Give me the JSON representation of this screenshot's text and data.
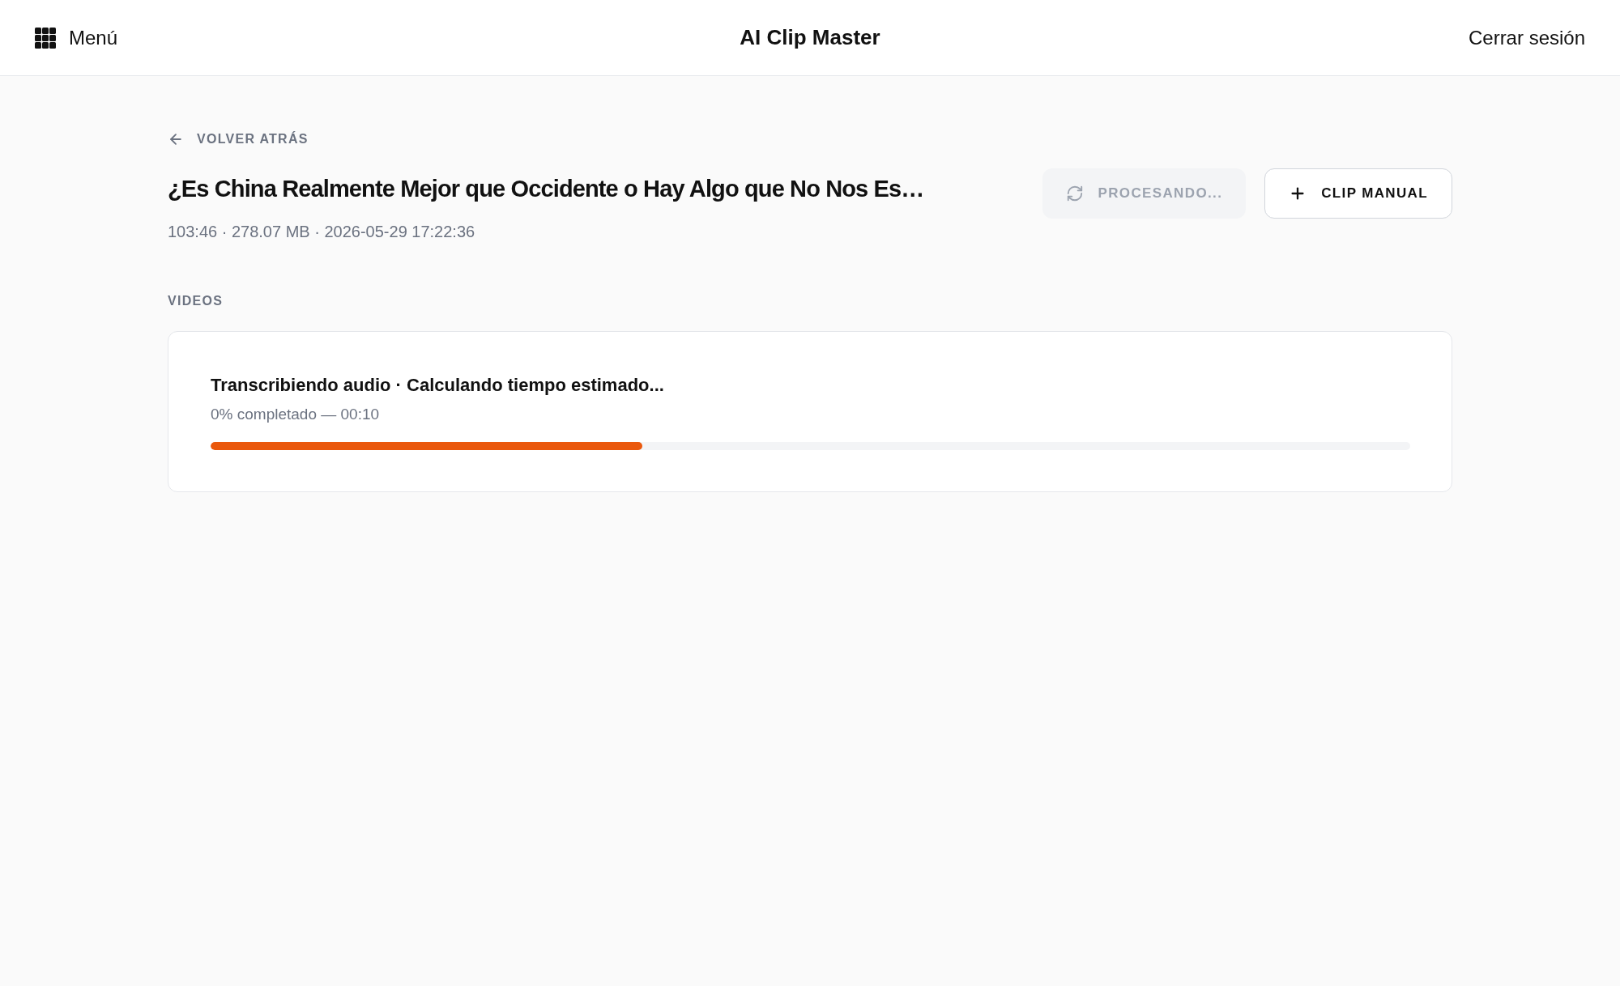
{
  "header": {
    "menu_button": {
      "label": "Menú"
    },
    "title": "AI Clip Master",
    "logout_button": {
      "label": "Cerrar sesión"
    }
  },
  "back_link": {
    "label": "VOLVER ATRÁS"
  },
  "video": {
    "title": "¿Es China Realmente Mejor que Occidente o Hay Algo que No Nos Es…",
    "meta": "103:46 · 278.07 MB · 2026-05-29 17:22:36"
  },
  "actions": [
    {
      "kind": "refresh",
      "label": "PROCESANDO...",
      "disabled": true
    },
    {
      "kind": "add",
      "label": "CLIP MANUAL",
      "disabled": false
    }
  ],
  "section_title": "VIDEOS",
  "jobs": [
    {
      "status": "Transcribiendo audio · Calculando tiempo estimado...",
      "progress_text": "0% completado — 00:10",
      "level": 0.36
    }
  ]
}
